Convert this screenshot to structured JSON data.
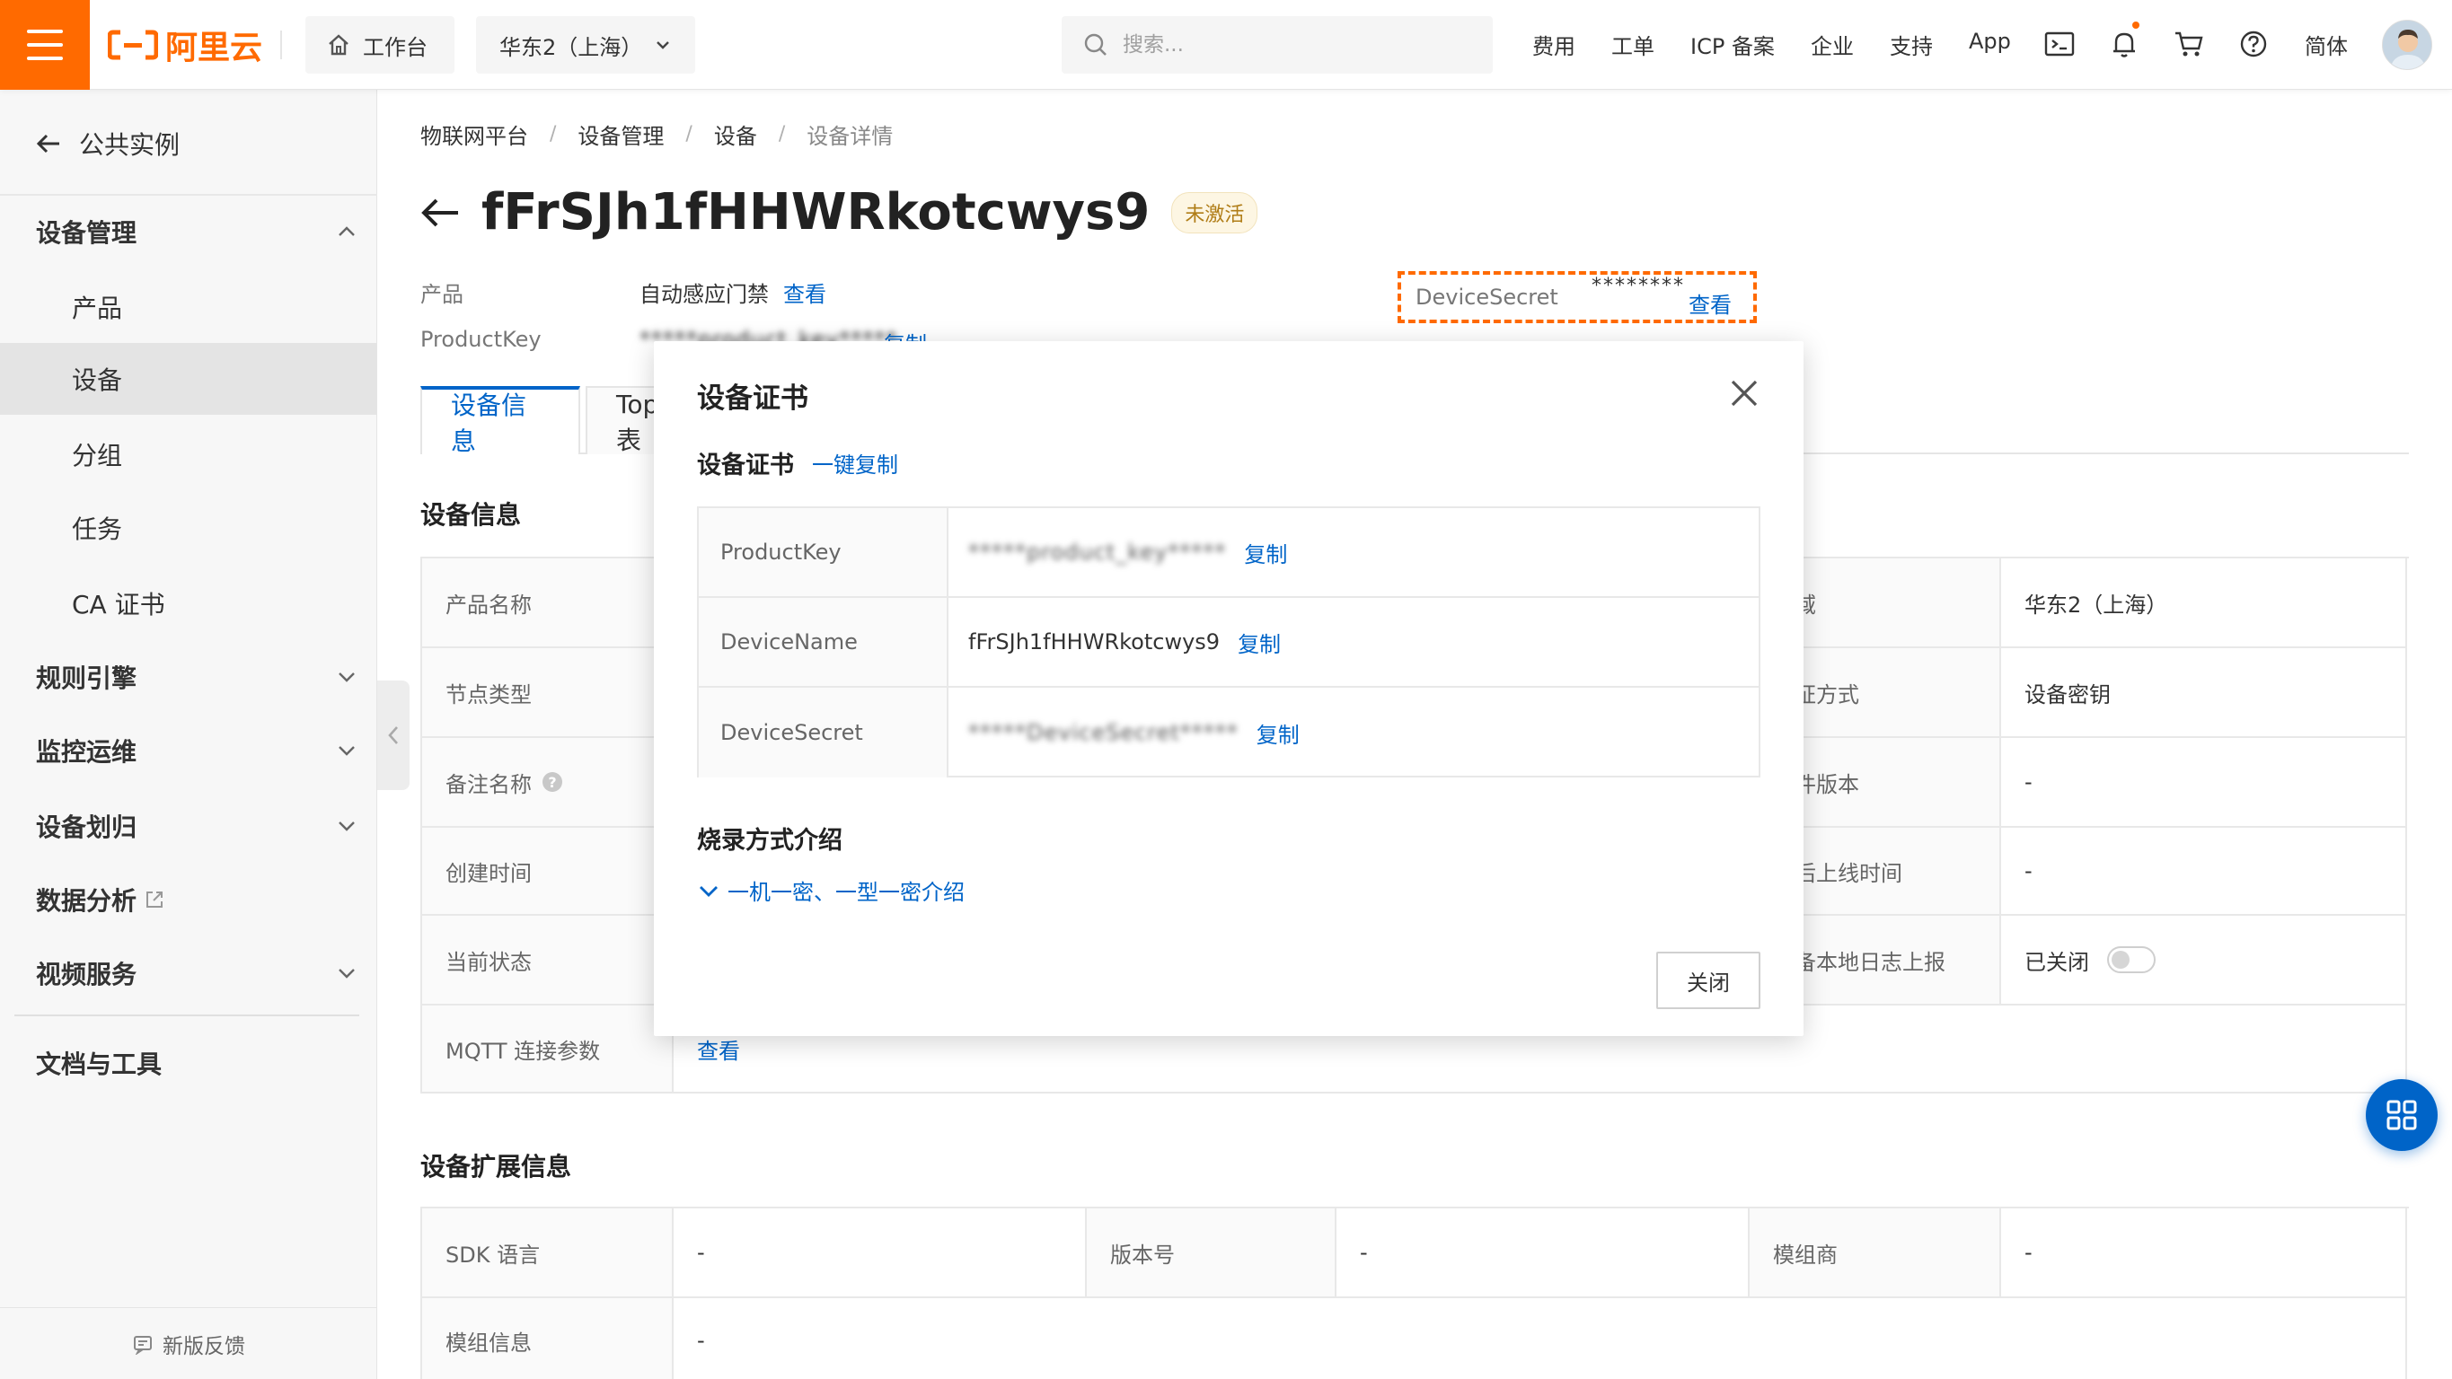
{
  "topbar": {
    "logo_text": "阿里云",
    "home_label": "工作台",
    "region_label": "华东2（上海）",
    "search_placeholder": "搜索...",
    "links": {
      "fee": "费用",
      "ticket": "工单",
      "icp": "ICP 备案",
      "enterprise": "企业",
      "support": "支持",
      "app": "App",
      "lang": "简体"
    },
    "brand_color": "#ff6a00"
  },
  "sidebar": {
    "back_label": "公共实例",
    "group_device_mgmt": "设备管理",
    "items": {
      "product": "产品",
      "device": "设备",
      "group": "分组",
      "task": "任务",
      "ca": "CA 证书"
    },
    "rules": "规则引擎",
    "monitor": "监控运维",
    "device_transfer": "设备划归",
    "data_analysis": "数据分析",
    "video": "视频服务",
    "docs": "文档与工具",
    "feedback": "新版反馈"
  },
  "breadcrumb": [
    "物联网平台",
    "设备管理",
    "设备",
    "设备详情"
  ],
  "breadcrumb_sep": "/",
  "device": {
    "name": "fFrSJh1fHHWRkotcwys9",
    "status": "未激活",
    "product_label": "产品",
    "product_value": "自动感应门禁",
    "view": "查看",
    "productkey_label": "ProductKey",
    "productkey_value": "*****product_key*****",
    "copy": "复制",
    "secret_label": "DeviceSecret",
    "secret_mask": "********"
  },
  "tabs": [
    "设备信息",
    "Topic 列表"
  ],
  "info": {
    "title": "设备信息",
    "left_labels": [
      "产品名称",
      "节点类型",
      "备注名称",
      "创建时间",
      "当前状态",
      "MQTT 连接参数"
    ],
    "mqtt_view": "查看",
    "right_labels": [
      "地域",
      "认证方式",
      "固件版本",
      "最后上线时间",
      "设备本地日志上报"
    ],
    "right_values": [
      "华东2（上海）",
      "设备密钥",
      "-",
      "-",
      "已关闭"
    ]
  },
  "ext": {
    "title": "设备扩展信息",
    "sdk_label": "SDK 语言",
    "sdk_value": "-",
    "ver_label": "版本号",
    "ver_value": "-",
    "vendor_label": "模组商",
    "vendor_value": "-",
    "module_label": "模组信息",
    "module_value": "-"
  },
  "modal": {
    "title": "设备证书",
    "subtitle": "设备证书",
    "copy_all": "一键复制",
    "rows": [
      {
        "key": "ProductKey",
        "value": "*****product_key*****",
        "blurred": true
      },
      {
        "key": "DeviceName",
        "value": "fFrSJh1fHHWRkotcwys9",
        "blurred": false
      },
      {
        "key": "DeviceSecret",
        "value": "*****DeviceSecret*****",
        "blurred": true
      }
    ],
    "copy": "复制",
    "burn_title": "烧录方式介绍",
    "burn_link": "一机一密、一型一密介绍",
    "close": "关闭"
  }
}
